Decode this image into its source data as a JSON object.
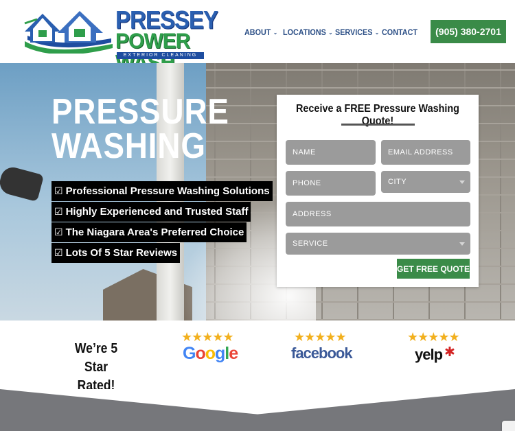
{
  "header": {
    "brand_line1": "PRESSEY",
    "brand_line2": "POWER WASH",
    "brand_line3": "EXTERIOR CLEANING",
    "nav": [
      {
        "label": "ABOUT",
        "has_dropdown": true
      },
      {
        "label": "LOCATIONS",
        "has_dropdown": true
      },
      {
        "label": "SERVICES",
        "has_dropdown": true
      },
      {
        "label": "CONTACT",
        "has_dropdown": false
      }
    ],
    "phone": "(905) 380-2701",
    "accent_green": "#3a8b48",
    "nav_color": "#2c4f86"
  },
  "hero": {
    "title_line1": "PRESSURE",
    "title_line2": "WASHING",
    "check_glyph": "☑",
    "bullets": [
      "Professional Pressure Washing Solutions",
      "Highly Experienced and Trusted Staff",
      "The Niagara Area's Preferred Choice",
      "Lots Of 5 Star Reviews"
    ]
  },
  "form": {
    "title": "Receive a FREE Pressure Washing Quote!",
    "name_placeholder": "NAME",
    "email_placeholder": "EMAIL ADDRESS",
    "phone_placeholder": "PHONE",
    "city_placeholder": "CITY",
    "address_placeholder": "ADDRESS",
    "service_placeholder": "SERVICE",
    "submit_label": "GET FREE QUOTE"
  },
  "reviews": {
    "heading_line1": "We’re 5 Star",
    "heading_line2": "Rated!",
    "stars": "★★★★★",
    "google": "Google",
    "facebook": "facebook",
    "yelp": "yelp",
    "star_color": "#f2b01e"
  }
}
